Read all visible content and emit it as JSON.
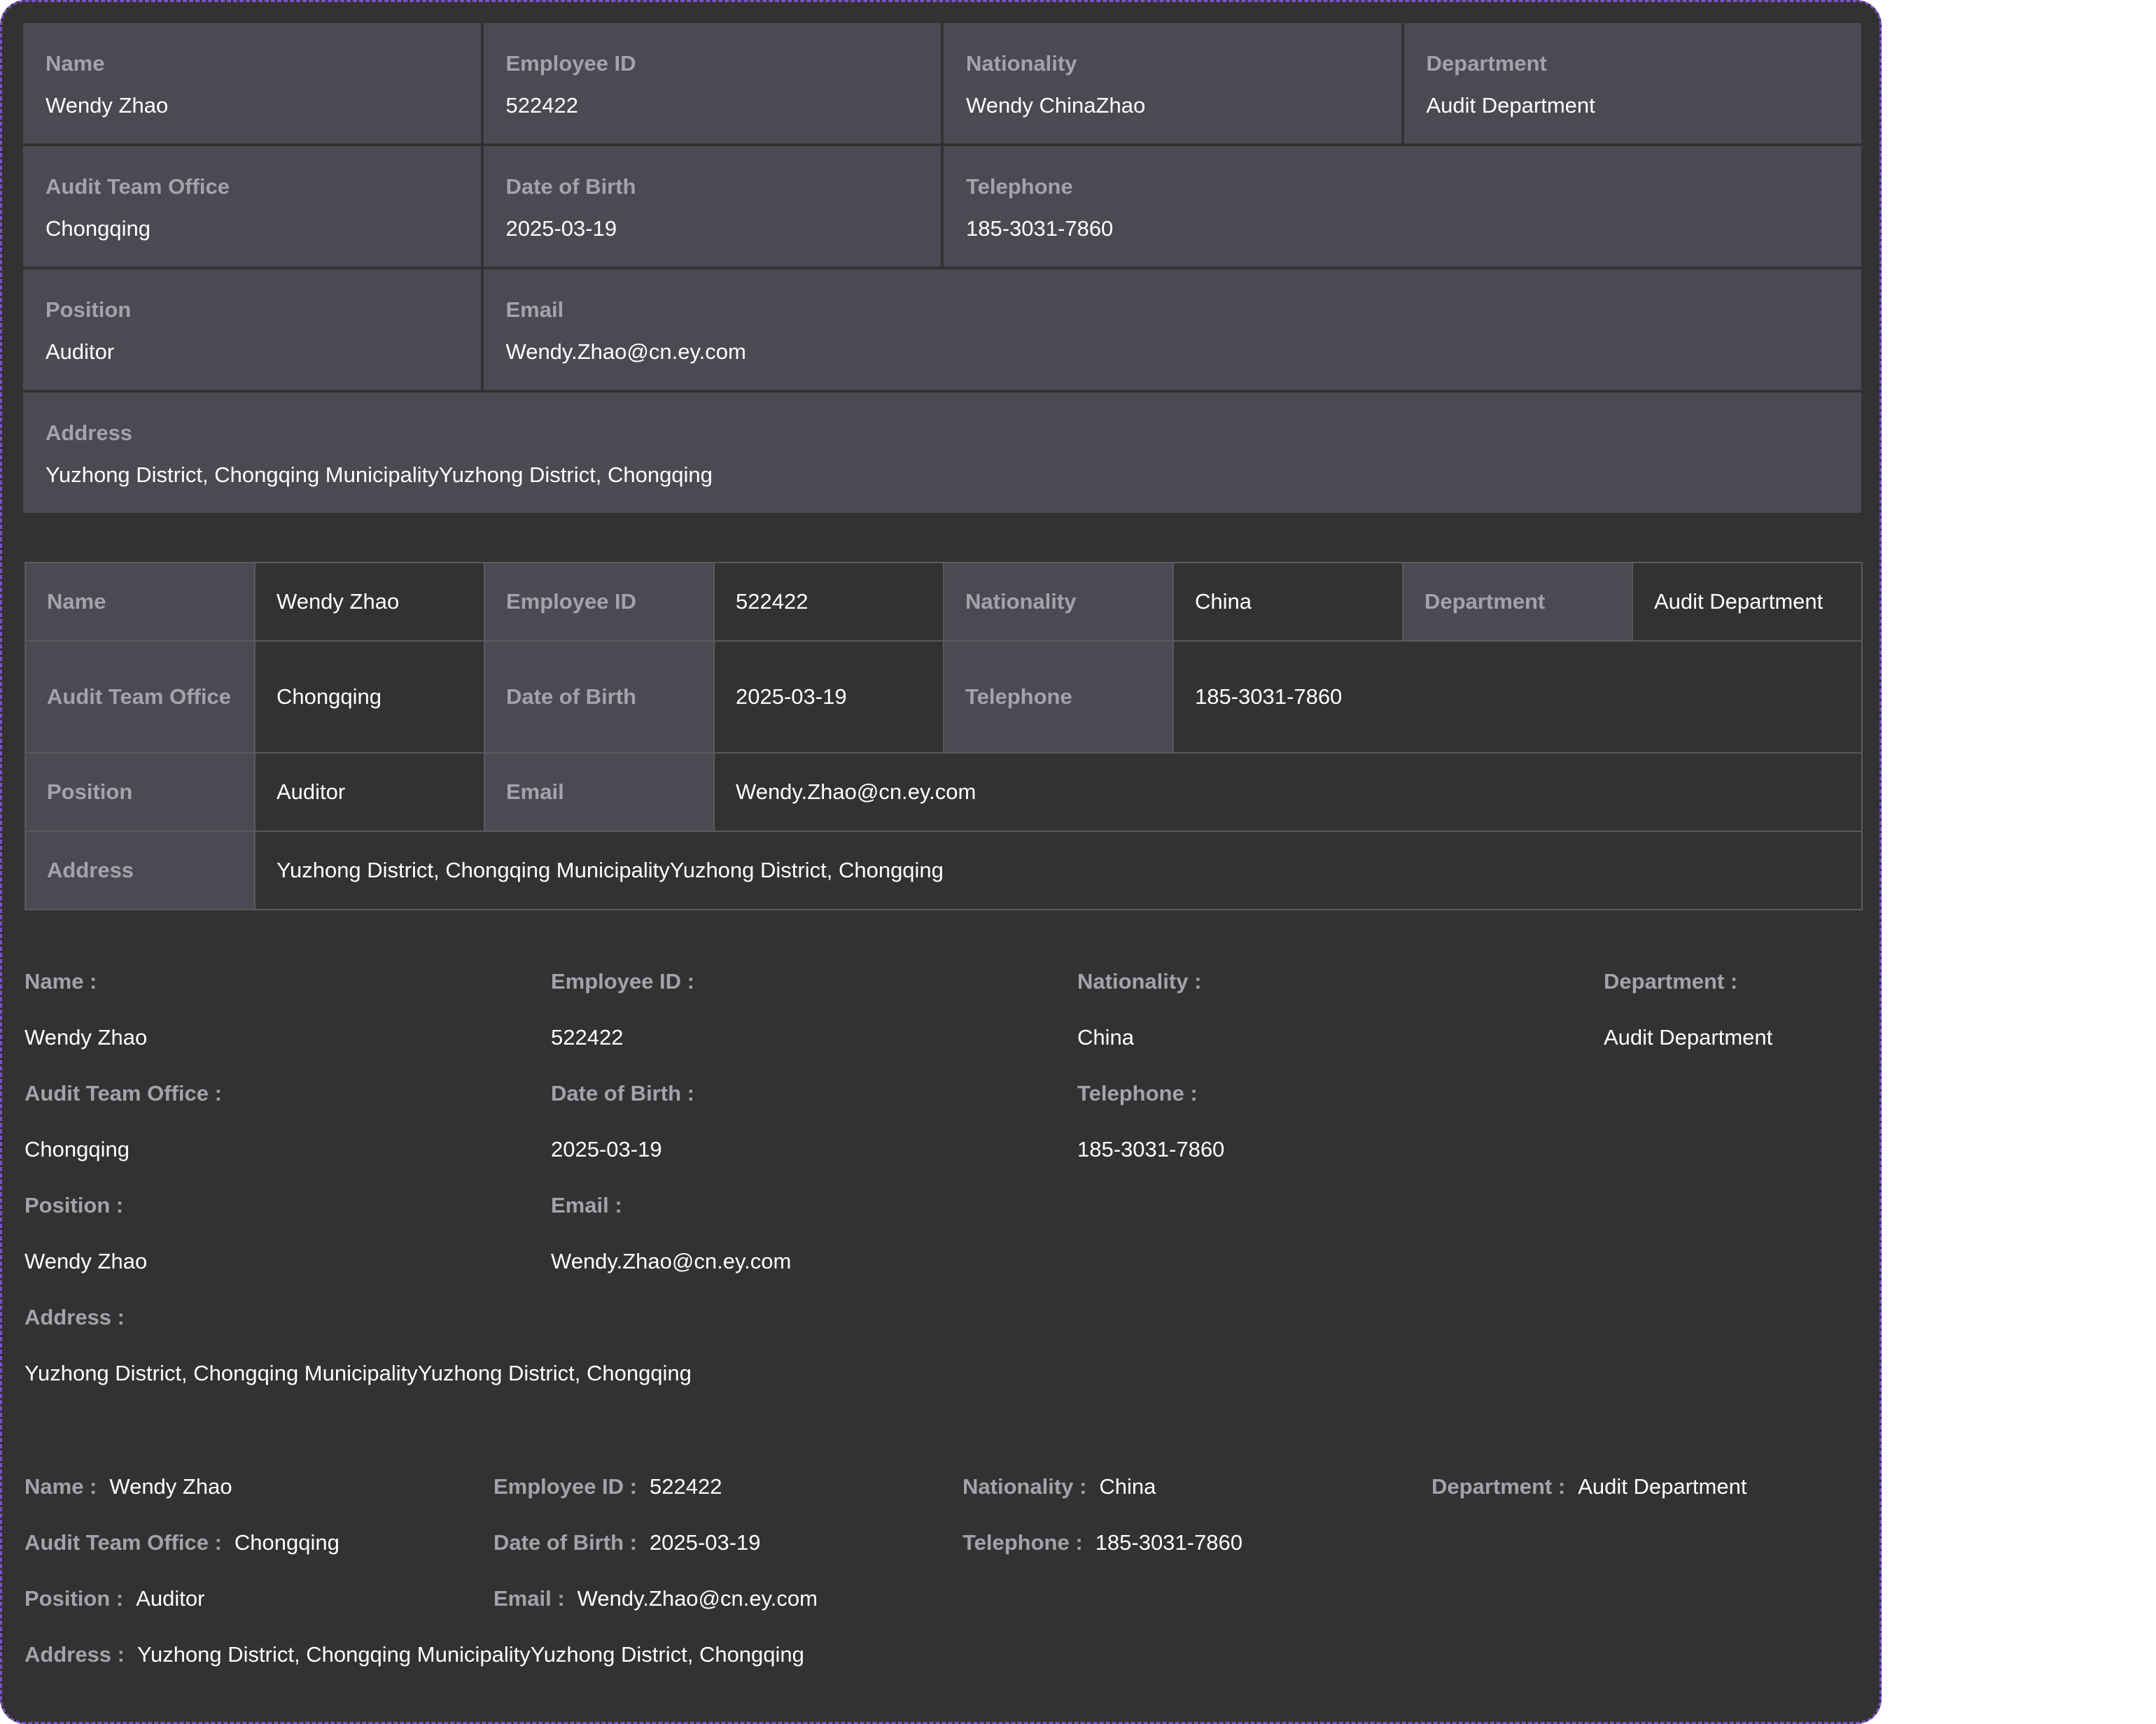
{
  "cards": {
    "name": {
      "label": "Name",
      "value": "Wendy Zhao"
    },
    "employee_id": {
      "label": "Employee ID",
      "value": "522422"
    },
    "nationality": {
      "label": "Nationality",
      "value": "Wendy ChinaZhao"
    },
    "department": {
      "label": "Department",
      "value": "Audit Department"
    },
    "audit_team_office": {
      "label": "Audit Team Office",
      "value": "Chongqing"
    },
    "date_of_birth": {
      "label": "Date of Birth",
      "value": "2025-03-19"
    },
    "telephone": {
      "label": "Telephone",
      "value": "185-3031-7860"
    },
    "position": {
      "label": "Position",
      "value": "Auditor"
    },
    "email": {
      "label": "Email",
      "value": "Wendy.Zhao@cn.ey.com"
    },
    "address": {
      "label": "Address",
      "value": "Yuzhong District, Chongqing MunicipalityYuzhong District, Chongqing"
    }
  },
  "table": {
    "name": {
      "label": "Name",
      "value": "Wendy Zhao"
    },
    "employee_id": {
      "label": "Employee ID",
      "value": "522422"
    },
    "nationality": {
      "label": "Nationality",
      "value": "China"
    },
    "department": {
      "label": "Department",
      "value": "Audit Department"
    },
    "audit_team_office": {
      "label": "Audit Team Office",
      "value": "Chongqing"
    },
    "date_of_birth": {
      "label": "Date of Birth",
      "value": "2025-03-19"
    },
    "telephone": {
      "label": "Telephone",
      "value": "185-3031-7860"
    },
    "position": {
      "label": "Position",
      "value": "Auditor"
    },
    "email": {
      "label": "Email",
      "value": "Wendy.Zhao@cn.ey.com"
    },
    "address": {
      "label": "Address",
      "value": "Yuzhong District, Chongqing MunicipalityYuzhong District, Chongqing"
    }
  },
  "vertical": {
    "name": {
      "label": "Name :",
      "value": "Wendy Zhao"
    },
    "employee_id": {
      "label": "Employee ID :",
      "value": "522422"
    },
    "nationality": {
      "label": "Nationality :",
      "value": "China"
    },
    "department": {
      "label": "Department :",
      "value": "Audit Department"
    },
    "audit_team_office": {
      "label": "Audit Team Office :",
      "value": "Chongqing"
    },
    "date_of_birth": {
      "label": "Date of Birth :",
      "value": "2025-03-19"
    },
    "telephone": {
      "label": "Telephone :",
      "value": "185-3031-7860"
    },
    "position": {
      "label": "Position :",
      "value": "Wendy Zhao"
    },
    "email": {
      "label": "Email :",
      "value": "Wendy.Zhao@cn.ey.com"
    },
    "address": {
      "label": "Address :",
      "value": "Yuzhong District, Chongqing MunicipalityYuzhong District, Chongqing"
    }
  },
  "inline": {
    "name": {
      "label": "Name :",
      "value": "Wendy Zhao"
    },
    "employee_id": {
      "label": "Employee ID :",
      "value": "522422"
    },
    "nationality": {
      "label": "Nationality :",
      "value": "China"
    },
    "department": {
      "label": "Department :",
      "value": "Audit Department"
    },
    "audit_team_office": {
      "label": "Audit Team Office :",
      "value": "Chongqing"
    },
    "date_of_birth": {
      "label": "Date of Birth :",
      "value": "2025-03-19"
    },
    "telephone": {
      "label": "Telephone :",
      "value": "185-3031-7860"
    },
    "position": {
      "label": "Position :",
      "value": "Auditor"
    },
    "email": {
      "label": "Email :",
      "value": "Wendy.Zhao@cn.ey.com"
    },
    "address": {
      "label": "Address :",
      "value": "Yuzhong District, Chongqing MunicipalityYuzhong District, Chongqing"
    }
  },
  "colors": {
    "background": "#323232",
    "label_cell": "#4a4a52",
    "label_text": "#a3a3ab",
    "value_text": "#ffffff",
    "frame_border": "#7b52c9"
  }
}
